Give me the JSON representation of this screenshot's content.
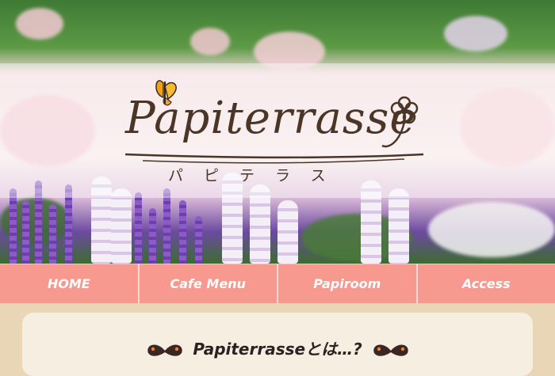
{
  "hero": {
    "logo_text": "Papiterrasse",
    "logo_subtitle": "パピテラス"
  },
  "nav": {
    "items": [
      {
        "label": "HOME"
      },
      {
        "label": "Cafe Menu"
      },
      {
        "label": "Papiroom"
      },
      {
        "label": "Access"
      }
    ]
  },
  "content": {
    "heading": "Papiterrasseとは…?"
  },
  "colors": {
    "nav_bg": "#f7998f",
    "page_bg": "#e8d6b6",
    "card_bg": "#f6efe1",
    "logo_ink": "#4a3526"
  }
}
